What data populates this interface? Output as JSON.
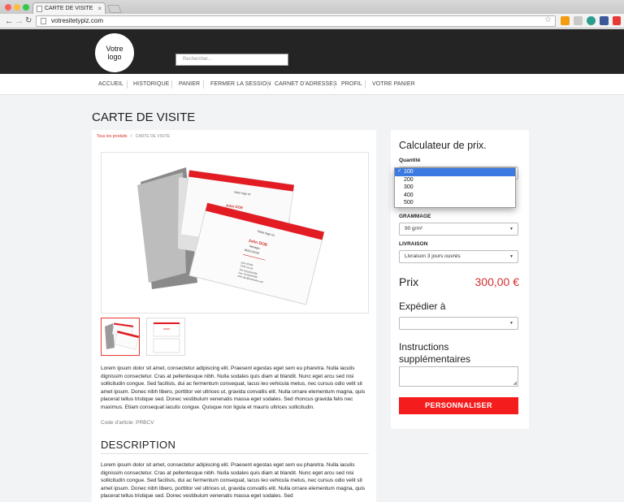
{
  "browser": {
    "tab_title": "CARTE DE VISITE",
    "url": "votresitetypiz.com"
  },
  "header": {
    "logo_text": "Votre logo",
    "search_placeholder": "Rechercher..."
  },
  "nav": {
    "items": [
      "ACCUEIL",
      "HISTORIQUE",
      "PANIER",
      "FERMER LA SESSION",
      "CARNET D'ADRESSES",
      "PROFIL",
      "VOTRE PANIER"
    ]
  },
  "page": {
    "title": "CARTE DE VISITE"
  },
  "breadcrumb": {
    "link": "Tous les produits",
    "separator": "/",
    "current": "CARTE DE VISITE"
  },
  "product": {
    "card_front": {
      "tagline": "Votre logo ici",
      "name": "John DOE",
      "role": "Manager",
      "phone": "0606102033"
    },
    "card_back": {
      "address_1": "john ACME",
      "address_2": "1234 rue de",
      "tel": "Tél: 0123456789",
      "fax": "Fax: 0123456789",
      "email": "john.doe@votresite.com"
    },
    "description_short": "Lorem ipsum dolor sit amet, consectetur adipiscing elit. Praesent egestas eget sem eu pharetra. Nulla iaculis dignissim consectetur. Cras at pellentesque nibh. Nulla sodales quis diam at blandit. Nunc eget arcu sed nisi sollicitudin congue. Sed facilisis, dui ac fermentum consequat, lacus leo vehicula metus, nec cursus odio velit sit amet ipsum. Donec nibh libero, porttitor vel ultrices ut, gravida convallis elit. Nulla ornare elementum magna, quis placerat tellus tristique sed. Donec vestibulum venenatis massa eget sodales. Sed rhoncus gravida felis nec maximus. Etiam consequat iaculis congue. Quisque non ligula et mauris ultrices sollicitudin.",
    "code_label": "Code d'article: PRBCV",
    "description_title": "DESCRIPTION",
    "description_long": "Lorem ipsum dolor sit amet, consectetur adipiscing elit. Praesent egestas eget sem eu pharetra. Nulla iaculis dignissim consectetur. Cras at pellentesque nibh. Nulla sodales quis diam at blandit. Nunc eget arcu sed nisi sollicitudin congue. Sed facilisis, dui ac fermentum consequat, lacus leo vehicula metus, nec cursus odio velit sit amet ipsum. Donec nibh libero, porttitor vel ultrices ut, gravida convallis elit. Nulla ornare elementum magna, quis placerat tellus tristique sed. Donec vestibulum venenatis massa eget sodales. Sed"
  },
  "calculator": {
    "title": "Calculateur de prix.",
    "quantity_label": "Quantité",
    "quantity_options": [
      "100",
      "200",
      "300",
      "400",
      "500"
    ],
    "quantity_selected": "100",
    "grammage_label": "GRAMMAGE",
    "grammage_value": "90 g/m²",
    "livraison_label": "LIVRAISON",
    "livraison_value": "Livraison 3 jours ouvrés",
    "price_label": "Prix",
    "price_value": "300,00 €",
    "ship_label": "Expédier à",
    "instructions_label": "Instructions supplémentaires",
    "cta_label": "PERSONNALISER"
  },
  "colors": {
    "accent_red": "#f41c1c",
    "header_dark": "#242424",
    "select_blue": "#3b7ae0"
  }
}
